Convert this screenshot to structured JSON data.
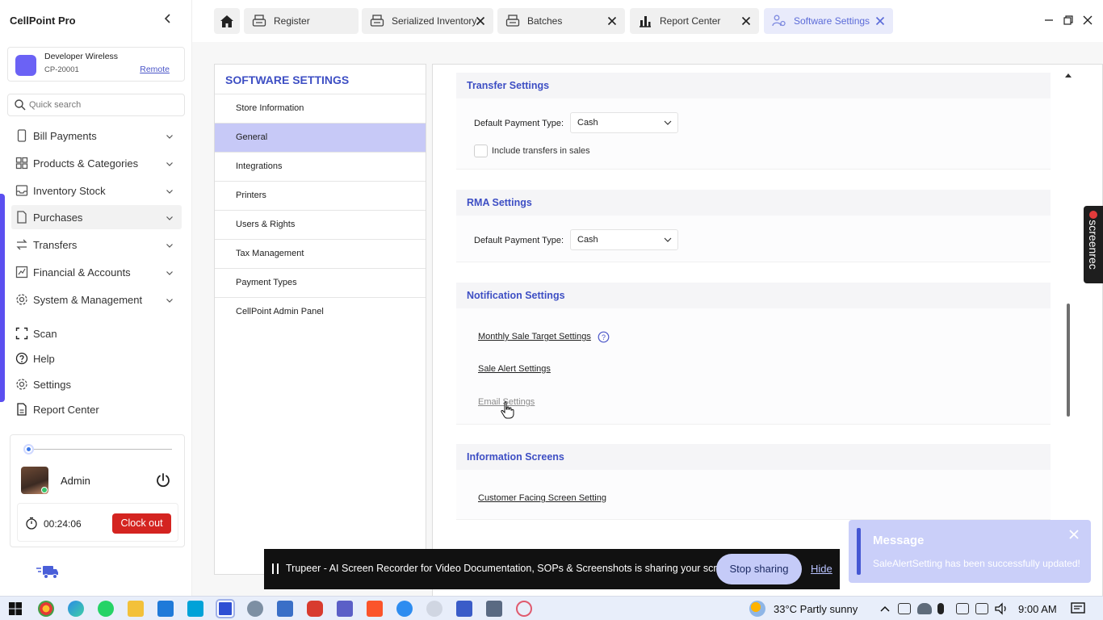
{
  "app": {
    "title": "CellPoint Pro",
    "store": {
      "name": "Developer Wireless",
      "code": "CP-20001",
      "remote_label": "Remote"
    },
    "search_placeholder": "Quick search"
  },
  "sidebar": {
    "items": [
      {
        "label": "Bill Payments",
        "icon": "phone-icon",
        "has_chevron": true
      },
      {
        "label": "Products & Categories",
        "icon": "grid-icon",
        "has_chevron": true
      },
      {
        "label": "Inventory Stock",
        "icon": "tray-icon",
        "has_chevron": true
      },
      {
        "label": "Purchases",
        "icon": "document-icon",
        "has_chevron": true,
        "active": true
      },
      {
        "label": "Transfers",
        "icon": "transfer-icon",
        "has_chevron": true
      },
      {
        "label": "Financial & Accounts",
        "icon": "chart-icon",
        "has_chevron": true
      },
      {
        "label": "System & Management",
        "icon": "gear-icon",
        "has_chevron": true
      },
      {
        "label": "Scan",
        "icon": "scan-icon"
      },
      {
        "label": "Help",
        "icon": "help-icon"
      },
      {
        "label": "Settings",
        "icon": "gear-icon"
      },
      {
        "label": "Report Center",
        "icon": "report-icon"
      }
    ]
  },
  "user": {
    "name": "Admin",
    "timer": "00:24:06",
    "clockout_label": "Clock out"
  },
  "tabs": [
    {
      "label": "Register",
      "icon": "register-icon",
      "closable": false
    },
    {
      "label": "Serialized Inventory",
      "icon": "register-icon",
      "closable": true
    },
    {
      "label": "Batches",
      "icon": "register-icon",
      "closable": true
    },
    {
      "label": "Report Center",
      "icon": "bar-chart-icon",
      "closable": true
    },
    {
      "label": "Software Settings",
      "icon": "users-gear-icon",
      "closable": true,
      "active": true
    }
  ],
  "settings_menu": {
    "title": "SOFTWARE SETTINGS",
    "items": [
      "Store Information",
      "General",
      "Integrations",
      "Printers",
      "Users & Rights",
      "Tax Management",
      "Payment Types",
      "CellPoint Admin Panel"
    ],
    "active": "General"
  },
  "content": {
    "transfer": {
      "title": "Transfer Settings",
      "payment_label": "Default Payment Type:",
      "payment_value": "Cash",
      "include_label": "Include transfers in sales",
      "include_checked": false
    },
    "rma": {
      "title": "RMA Settings",
      "payment_label": "Default Payment Type:",
      "payment_value": "Cash"
    },
    "notification": {
      "title": "Notification Settings",
      "links": [
        "Monthly Sale Target Settings",
        "Sale Alert Settings",
        "Email Settings"
      ]
    },
    "information": {
      "title": "Information Screens",
      "links": [
        "Customer Facing Screen Setting"
      ]
    }
  },
  "screenrec_label": "screenrec",
  "share_bar": {
    "text": "Trupeer - AI Screen Recorder for Video Documentation, SOPs & Screenshots is sharing your screen.",
    "stop_label": "Stop sharing",
    "hide_label": "Hide"
  },
  "toast": {
    "title": "Message",
    "message": "SaleAlertSetting has been successfully updated!"
  },
  "taskbar": {
    "weather": "33°C  Partly sunny",
    "time": "9:00 AM"
  },
  "colors": {
    "accent": "#3e4fc4",
    "sidebar_accent": "#5b4ff0",
    "clockout": "#d42420",
    "active_menu": "#c7c9f7"
  }
}
